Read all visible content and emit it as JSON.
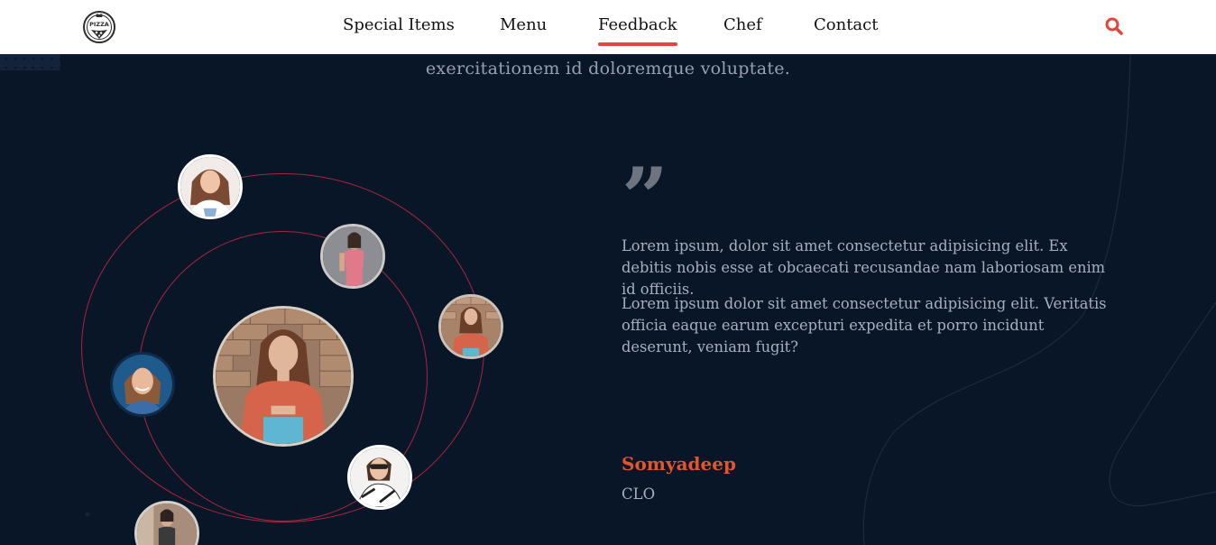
{
  "header": {
    "logo_text": "PIZZA",
    "nav": [
      {
        "label": "Special Items"
      },
      {
        "label": "Menu"
      },
      {
        "label": "Feedback"
      },
      {
        "label": "Chef"
      },
      {
        "label": "Contact"
      }
    ],
    "active_nav": "Feedback",
    "search_icon": "search-icon"
  },
  "section": {
    "subtitle": "exercitationem id doloremque voluptate."
  },
  "testimonial": {
    "quote_mark": "”",
    "paragraphs": [
      "Lorem ipsum, dolor sit amet consectetur adipisicing elit. Ex debitis nobis esse at obcaecati recusandae nam laboriosam enim id officiis.",
      "Lorem ipsum dolor sit amet consectetur adipisicing elit. Veritatis officia eaque earum excepturi expedita et porro incidunt deserunt, veniam fugit?"
    ],
    "name": "Somyadeep",
    "role": "CLO"
  },
  "colors": {
    "accent": "#e2453c",
    "background": "#091627",
    "orbit": "#a8243e"
  }
}
